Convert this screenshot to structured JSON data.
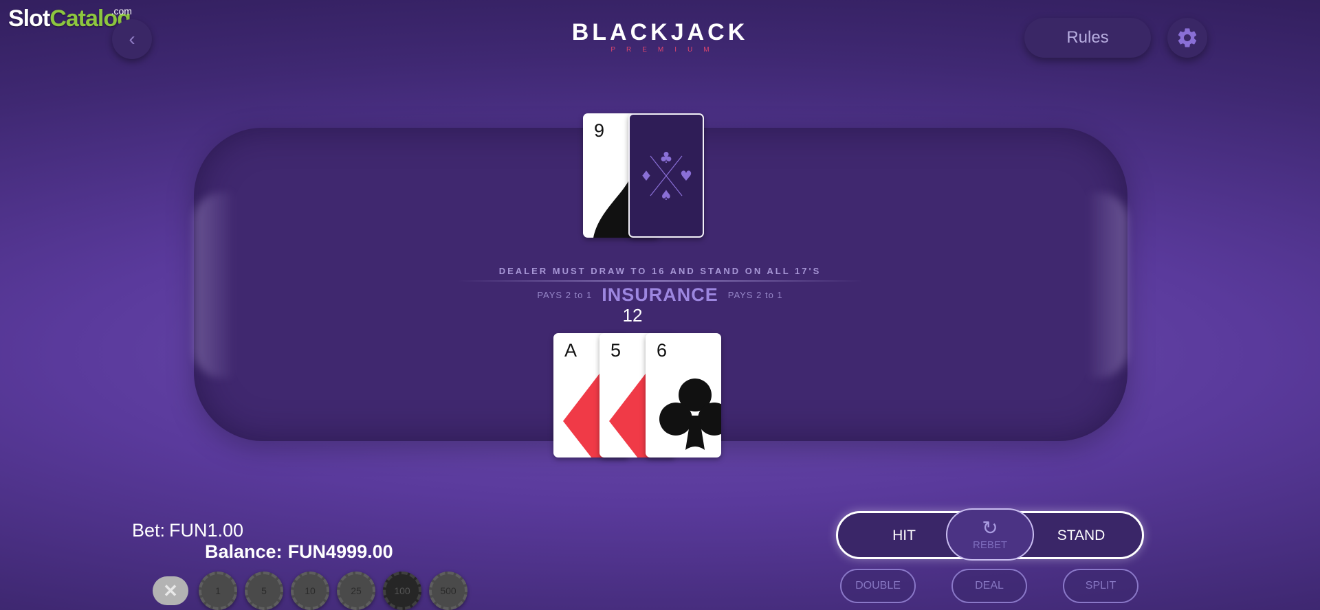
{
  "watermark": {
    "brand_a": "Slot",
    "brand_b": "Catalog",
    "suffix": ".com"
  },
  "header": {
    "back_icon": "chevron-left-icon",
    "title": "BLACKJACK",
    "subtitle": "PREMIUM",
    "rules_label": "Rules",
    "settings_icon": "gear-icon"
  },
  "table": {
    "rule_text": "DEALER MUST DRAW TO 16 AND STAND ON ALL 17'S",
    "insurance_title": "INSURANCE",
    "insurance_pays_left": "PAYS 2 to 1",
    "insurance_pays_right": "PAYS 2 to 1"
  },
  "dealer": {
    "cards": [
      {
        "rank": "9",
        "suit": "spades",
        "face_up": true
      },
      {
        "face_up": false
      }
    ]
  },
  "player": {
    "score": "12",
    "cards": [
      {
        "rank": "A",
        "suit": "diamonds"
      },
      {
        "rank": "5",
        "suit": "diamonds"
      },
      {
        "rank": "6",
        "suit": "clubs"
      }
    ]
  },
  "wallet": {
    "bet_label": "Bet:",
    "bet_value": "FUN1.00",
    "balance_label": "Balance:",
    "balance_value": "FUN4999.00"
  },
  "chips": {
    "clear_icon": "close-icon",
    "values": [
      "1",
      "5",
      "10",
      "25",
      "100",
      "500"
    ]
  },
  "actions": {
    "hit": "HIT",
    "rebet": "REBET",
    "stand": "STAND",
    "double": "DOUBLE",
    "deal": "DEAL",
    "split": "SPLIT"
  },
  "colors": {
    "background": "#5a3a9c",
    "table": "#40286f",
    "accent_red": "#e0466e",
    "watermark_green": "#8dc63f",
    "suit_red": "#f03a47"
  }
}
